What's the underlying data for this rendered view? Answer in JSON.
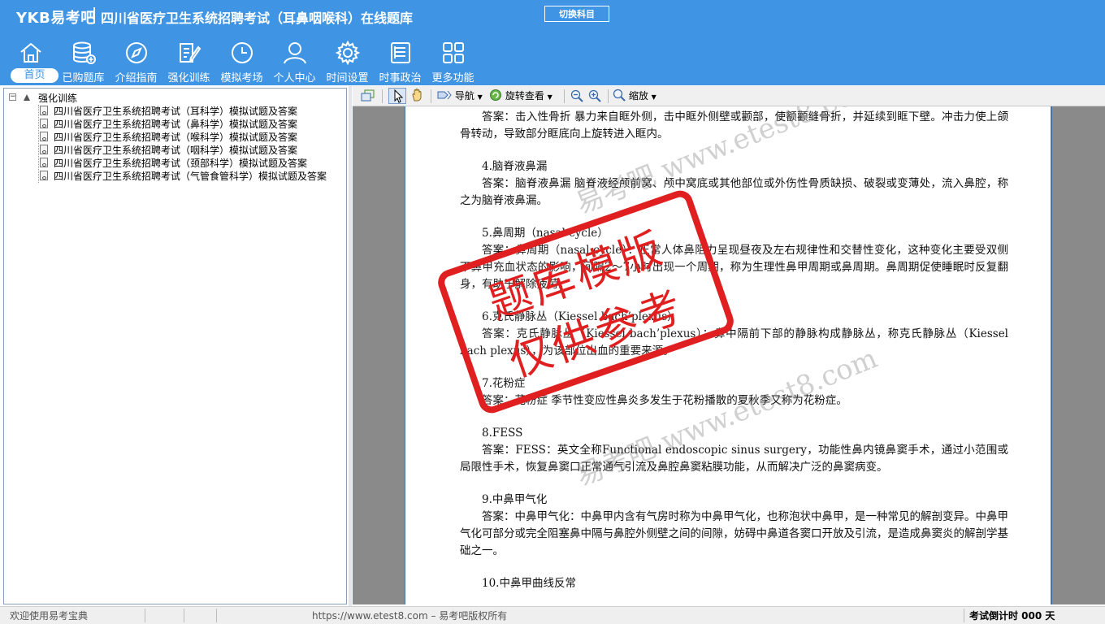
{
  "header": {
    "logo": "YKB易考吧",
    "title": "四川省医疗卫生系统招聘考试（耳鼻咽喉科）在线题库",
    "switch_subject": "切换科目"
  },
  "nav": [
    {
      "label": "首页",
      "icon": "home-icon"
    },
    {
      "label": "已购题库",
      "icon": "database-icon"
    },
    {
      "label": "介绍指南",
      "icon": "compass-icon"
    },
    {
      "label": "强化训练",
      "icon": "edit-icon"
    },
    {
      "label": "模拟考场",
      "icon": "clock-icon"
    },
    {
      "label": "个人中心",
      "icon": "user-icon"
    },
    {
      "label": "时间设置",
      "icon": "gear-icon"
    },
    {
      "label": "时事政治",
      "icon": "news-icon"
    },
    {
      "label": "更多功能",
      "icon": "grid-icon"
    }
  ],
  "tree": {
    "root": "强化训练",
    "items": [
      "四川省医疗卫生系统招聘考试（耳科学）模拟试题及答案",
      "四川省医疗卫生系统招聘考试（鼻科学）模拟试题及答案",
      "四川省医疗卫生系统招聘考试（喉科学）模拟试题及答案",
      "四川省医疗卫生系统招聘考试（咽科学）模拟试题及答案",
      "四川省医疗卫生系统招聘考试（颈部科学）模拟试题及答案",
      "四川省医疗卫生系统招聘考试（气管食管科学）模拟试题及答案"
    ]
  },
  "toolbar": {
    "navigate": "导航",
    "rotate": "旋转查看",
    "zoom": "缩放"
  },
  "document": {
    "paragraphs": [
      {
        "type": "a",
        "text": "答案：击入性骨折 暴力来自眶外侧，击中眶外侧壁或颧部，使额颧缝骨折，并延续到眶下壁。冲击力使上颌骨转动，导致部分眶底向上旋转进入眶内。"
      },
      {
        "type": "q",
        "text": "4.脑脊液鼻漏"
      },
      {
        "type": "a",
        "text": "答案：脑脊液鼻漏 脑脊液经颅前窝、颅中窝底或其他部位或外伤性骨质缺损、破裂或变薄处，流入鼻腔，称之为脑脊液鼻漏。"
      },
      {
        "type": "q",
        "text": "5.鼻周期（nasal cycle）"
      },
      {
        "type": "a",
        "text": "答案：鼻周期（nasal cycle）：正常人体鼻阻力呈现昼夜及左右规律性和交替性变化，这种变化主要受双侧下鼻甲充血状态的影响，间隔2～7小时出现一个周期，称为生理性鼻甲周期或鼻周期。鼻周期促使睡眠时反复翻身，有助于解除疲劳。"
      },
      {
        "type": "q",
        "text": "6.克氏静脉丛（Kiessel bach’plexus）"
      },
      {
        "type": "a",
        "text": "答案：克氏静脉丛（Kiessel bach’plexus）：鼻中隔前下部的静脉构成静脉丛，称克氏静脉丛（Kiessel bach plexus），为该部位出血的重要来源。"
      },
      {
        "type": "q",
        "text": "7.花粉症"
      },
      {
        "type": "a",
        "text": "答案：花粉症 季节性变应性鼻炎多发生于花粉播散的夏秋季又称为花粉症。"
      },
      {
        "type": "q",
        "text": "8.FESS"
      },
      {
        "type": "a",
        "text": "答案：FESS：英文全称Functional endoscopic sinus surgery，功能性鼻内镜鼻窦手术，通过小范围或局限性手术，恢复鼻窦口正常通气引流及鼻腔鼻窦粘膜功能，从而解决广泛的鼻窦病变。"
      },
      {
        "type": "q",
        "text": "9.中鼻甲气化"
      },
      {
        "type": "a",
        "text": "答案：中鼻甲气化：中鼻甲内含有气房时称为中鼻甲气化，也称泡状中鼻甲，是一种常见的解剖变异。中鼻甲气化可部分或完全阻塞鼻中隔与鼻腔外侧壁之间的间隙，妨碍中鼻道各窦口开放及引流，是造成鼻窦炎的解剖学基础之一。"
      },
      {
        "type": "q",
        "text": "10.中鼻甲曲线反常"
      }
    ],
    "stamp_line1": "题库模版",
    "stamp_line2": "仅供参考",
    "watermark": "易考吧 www.etest8.com"
  },
  "status": {
    "welcome": "欢迎使用易考宝典",
    "copyright": "https://www.etest8.com – 易考吧版权所有",
    "countdown": "考试倒计时 000 天"
  },
  "colors": {
    "header_bg": "#3f95e3",
    "stamp_red": "#e02020"
  }
}
